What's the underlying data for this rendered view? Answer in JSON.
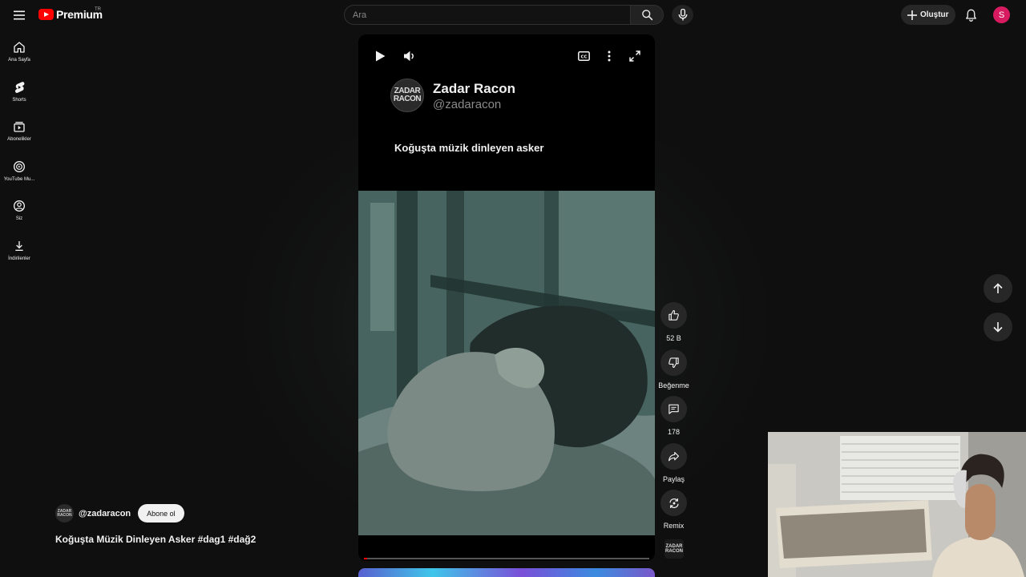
{
  "header": {
    "logo_text": "Premium",
    "country_code": "TR",
    "search_placeholder": "Ara",
    "create_label": "Oluştur",
    "avatar_letter": "S"
  },
  "sidebar": {
    "items": [
      {
        "label": "Ana Sayfa",
        "icon": "home-icon"
      },
      {
        "label": "Shorts",
        "icon": "shorts-icon"
      },
      {
        "label": "Abonelikler",
        "icon": "subscriptions-icon"
      },
      {
        "label": "YouTube Mu...",
        "icon": "youtube-music-icon"
      },
      {
        "label": "Siz",
        "icon": "you-icon"
      },
      {
        "label": "İndirilenler",
        "icon": "downloads-icon"
      }
    ]
  },
  "player": {
    "overlay_channel_name": "Zadar Racon",
    "overlay_channel_handle": "@zadaracon",
    "overlay_caption": "Koğuşta müzik dinleyen asker",
    "logo_line1": "ZADAR",
    "logo_line2": "RACON",
    "progress": 0.01,
    "accent_color": "#ff0000"
  },
  "actions": {
    "like_count": "52 B",
    "dislike_label": "Beğenme",
    "comment_count": "178",
    "share_label": "Paylaş",
    "remix_label": "Remix"
  },
  "info": {
    "channel_handle": "@zadaracon",
    "subscribe_label": "Abone ol",
    "title": "Koğuşta Müzik Dinleyen Asker #dag1 #dağ2"
  }
}
